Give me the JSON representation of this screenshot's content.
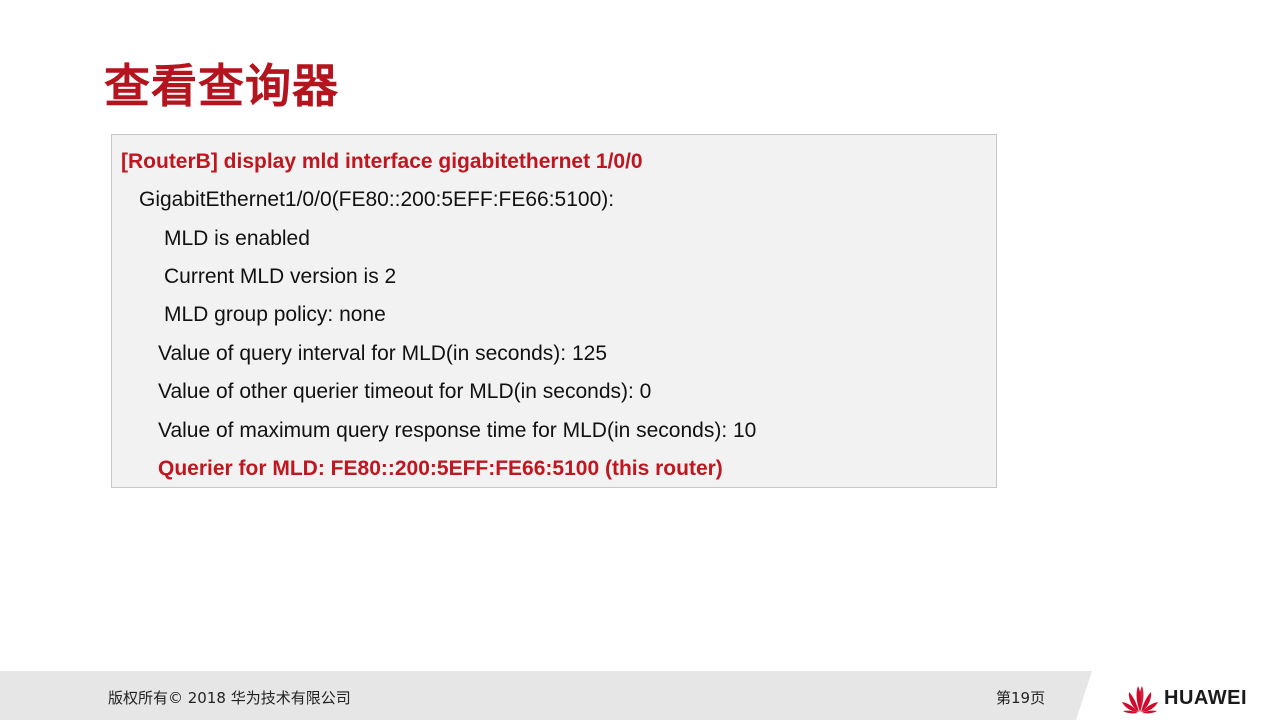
{
  "title": "查看查询器",
  "command_box": {
    "lines": [
      {
        "text": "[RouterB] display mld interface gigabitethernet 1/0/0",
        "highlight": true
      },
      {
        "text": "GigabitEthernet1/0/0(FE80::200:5EFF:FE66:5100):",
        "highlight": false
      },
      {
        "text": "MLD is enabled",
        "highlight": false
      },
      {
        "text": "Current MLD version is 2",
        "highlight": false
      },
      {
        "text": "MLD group policy: none",
        "highlight": false
      },
      {
        "text": "Value of query interval for MLD(in seconds): 125",
        "highlight": false
      },
      {
        "text": "Value of other querier timeout for MLD(in seconds): 0",
        "highlight": false
      },
      {
        "text": "Value of maximum query response time for MLD(in seconds): 10",
        "highlight": false
      },
      {
        "text": "Querier for MLD: FE80::200:5EFF:FE66:5100 (this router)",
        "highlight": true
      }
    ]
  },
  "footer": {
    "copyright": "版权所有© 2018 华为技术有限公司",
    "page": "第19页",
    "brand": "HUAWEI"
  },
  "colors": {
    "accent_red": "#c0161f",
    "title_red": "#b3141d",
    "box_bg": "#f2f2f2",
    "footer_bg": "#e6e6e6"
  },
  "icons": {
    "logo": "huawei-flower-logo-icon"
  }
}
